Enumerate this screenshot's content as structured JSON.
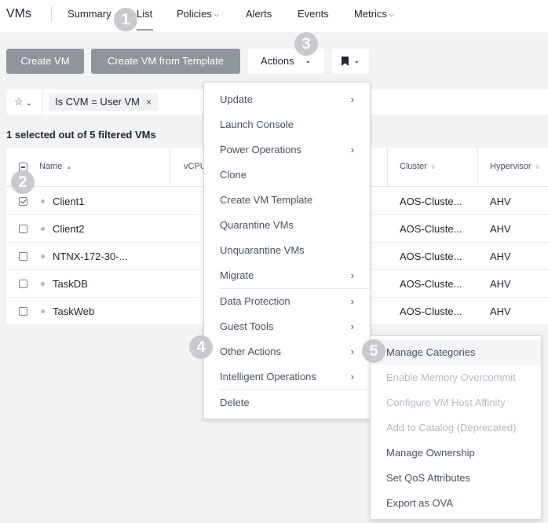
{
  "header": {
    "app_title": "VMs",
    "nav": [
      {
        "label": "Summary",
        "chevron": false
      },
      {
        "label": "List",
        "chevron": false
      },
      {
        "label": "Policies",
        "chevron": true
      },
      {
        "label": "Alerts",
        "chevron": false
      },
      {
        "label": "Events",
        "chevron": false
      },
      {
        "label": "Metrics",
        "chevron": true
      }
    ],
    "active_tab": "List"
  },
  "toolbar": {
    "create_vm_label": "Create VM",
    "create_vm_template_label": "Create VM from Template",
    "actions_label": "Actions",
    "bookmark_icon": "bookmark-icon"
  },
  "filter": {
    "favorite_icon": "star-icon",
    "chip_label": "Is CVM = User VM",
    "chip_remove": "×"
  },
  "summary_text": "1 selected out of 5 filtered VMs",
  "table": {
    "columns": [
      "Name",
      "vCPU",
      "Cluster",
      "Hypervisor"
    ],
    "rows": [
      {
        "name": "Client1",
        "selected": true,
        "cluster": "AOS-Cluste...",
        "hypervisor": "AHV"
      },
      {
        "name": "Client2",
        "selected": false,
        "cluster": "AOS-Cluste...",
        "hypervisor": "AHV"
      },
      {
        "name": "NTNX-172-30-...",
        "selected": false,
        "cluster": "AOS-Cluste...",
        "hypervisor": "AHV"
      },
      {
        "name": "TaskDB",
        "selected": false,
        "cluster": "AOS-Cluste...",
        "hypervisor": "AHV"
      },
      {
        "name": "TaskWeb",
        "selected": false,
        "cluster": "AOS-Cluste...",
        "hypervisor": "AHV"
      }
    ]
  },
  "actions_menu": {
    "items": [
      {
        "label": "Update",
        "submenu": true
      },
      {
        "label": "Launch Console",
        "submenu": false
      },
      {
        "label": "Power Operations",
        "submenu": true
      },
      {
        "label": "Clone",
        "submenu": false
      },
      {
        "label": "Create VM Template",
        "submenu": false
      },
      {
        "label": "Quarantine VMs",
        "submenu": false
      },
      {
        "label": "Unquarantine VMs",
        "submenu": false
      },
      {
        "label": "Migrate",
        "submenu": true
      },
      {
        "label": "Data Protection",
        "submenu": true
      },
      {
        "label": "Guest Tools",
        "submenu": true
      },
      {
        "label": "Other Actions",
        "submenu": true
      },
      {
        "label": "Intelligent Operations",
        "submenu": true
      },
      {
        "label": "Delete",
        "submenu": false
      }
    ]
  },
  "other_actions_menu": {
    "items": [
      {
        "label": "Manage Categories",
        "enabled": true,
        "suffix": ""
      },
      {
        "label": "Enable Memory Overcommit",
        "enabled": false,
        "suffix": ""
      },
      {
        "label": "Configure VM Host Affinity",
        "enabled": false,
        "suffix": ""
      },
      {
        "label": "Add to Catalog",
        "enabled": false,
        "suffix": "(Deprecated)"
      },
      {
        "label": "Manage Ownership",
        "enabled": true,
        "suffix": ""
      },
      {
        "label": "Set QoS Attributes",
        "enabled": true,
        "suffix": ""
      },
      {
        "label": "Export as OVA",
        "enabled": true,
        "suffix": ""
      }
    ]
  },
  "callouts": [
    "1",
    "2",
    "3",
    "4",
    "5"
  ],
  "colors": {
    "primary_button": "#8f959c",
    "badge": "#c8cacd",
    "page_background": "#f2f3f5"
  }
}
